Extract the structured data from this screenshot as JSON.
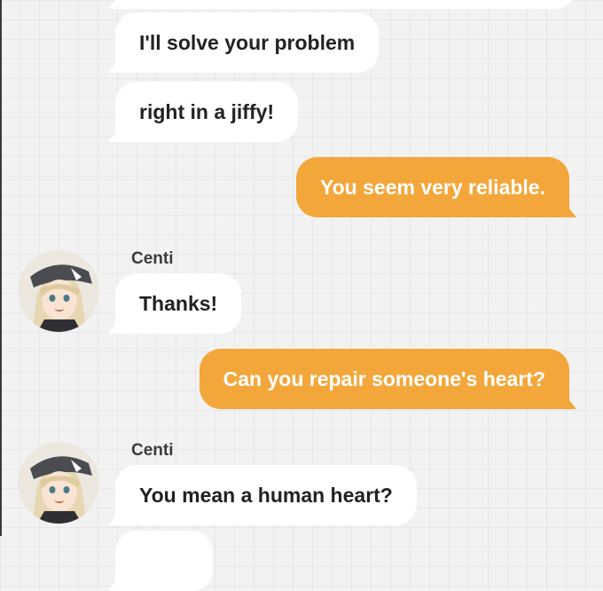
{
  "theme": {
    "outgoing_bubble_color": "#f3a73b",
    "incoming_bubble_color": "#ffffff"
  },
  "messages": [
    {
      "side": "incoming",
      "text": "I'll solve your problem"
    },
    {
      "side": "incoming",
      "text": "right in a jiffy!"
    },
    {
      "side": "outgoing",
      "text": "You seem very reliable."
    },
    {
      "side": "incoming",
      "sender": "Centi",
      "avatar": "centi-avatar",
      "text": "Thanks!"
    },
    {
      "side": "outgoing",
      "text": "Can you repair someone's heart?"
    },
    {
      "side": "incoming",
      "sender": "Centi",
      "avatar": "centi-avatar",
      "text": "You mean a human heart?"
    }
  ]
}
